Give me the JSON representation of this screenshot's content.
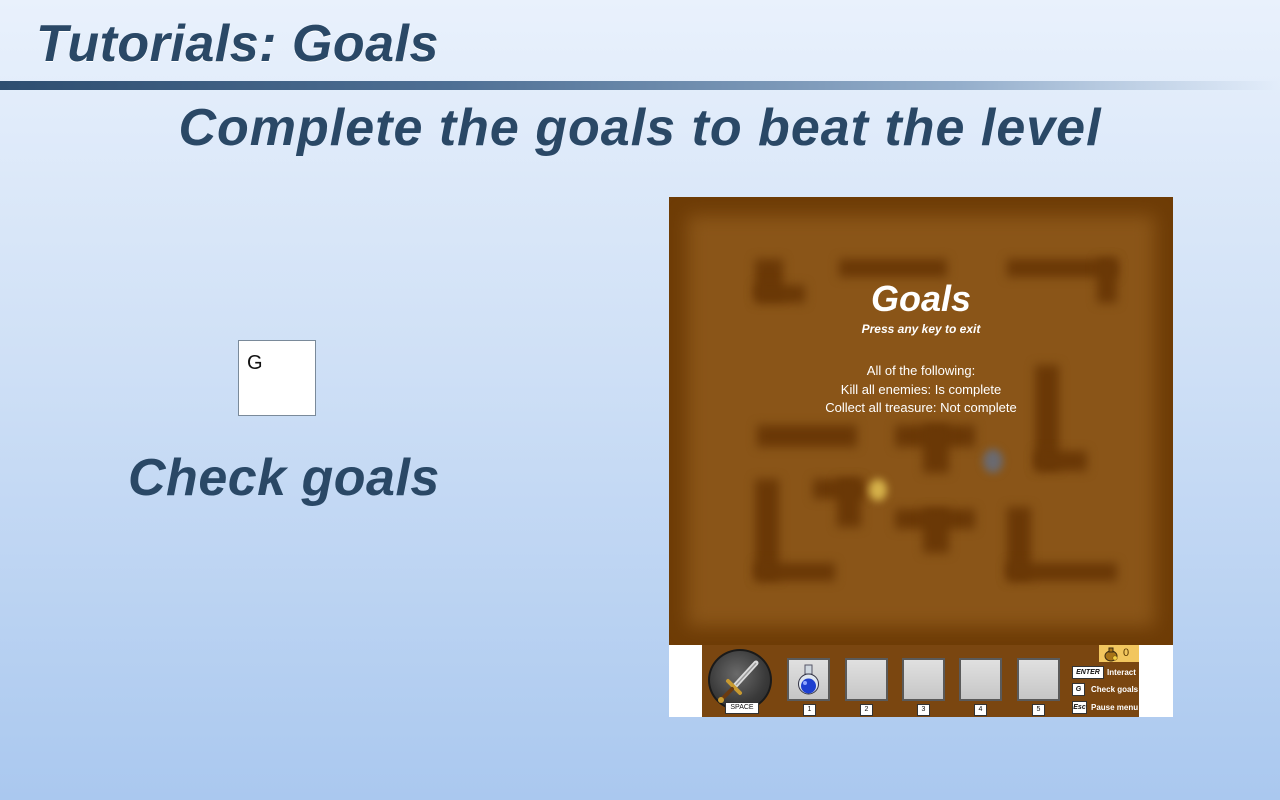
{
  "header": {
    "title": "Tutorials: Goals",
    "subtitle": "Complete the goals to beat the level"
  },
  "tutorial": {
    "key": "G",
    "action_label": "Check goals"
  },
  "game": {
    "overlay": {
      "title": "Goals",
      "hint": "Press any key to exit",
      "lines": [
        "All of the following:",
        "Kill all enemies: Is complete",
        "Collect all treasure: Not complete"
      ]
    },
    "hud": {
      "attack_key": "SPACE",
      "gold_count": "0",
      "slots": [
        {
          "key": "1",
          "item": "potion-icon"
        },
        {
          "key": "2",
          "item": ""
        },
        {
          "key": "3",
          "item": ""
        },
        {
          "key": "4",
          "item": ""
        },
        {
          "key": "5",
          "item": ""
        }
      ],
      "controls": [
        {
          "key": "ENTER",
          "label": "Interact"
        },
        {
          "key": "G",
          "label": "Check goals"
        },
        {
          "key": "Esc",
          "label": "Pause menu"
        }
      ]
    }
  }
}
